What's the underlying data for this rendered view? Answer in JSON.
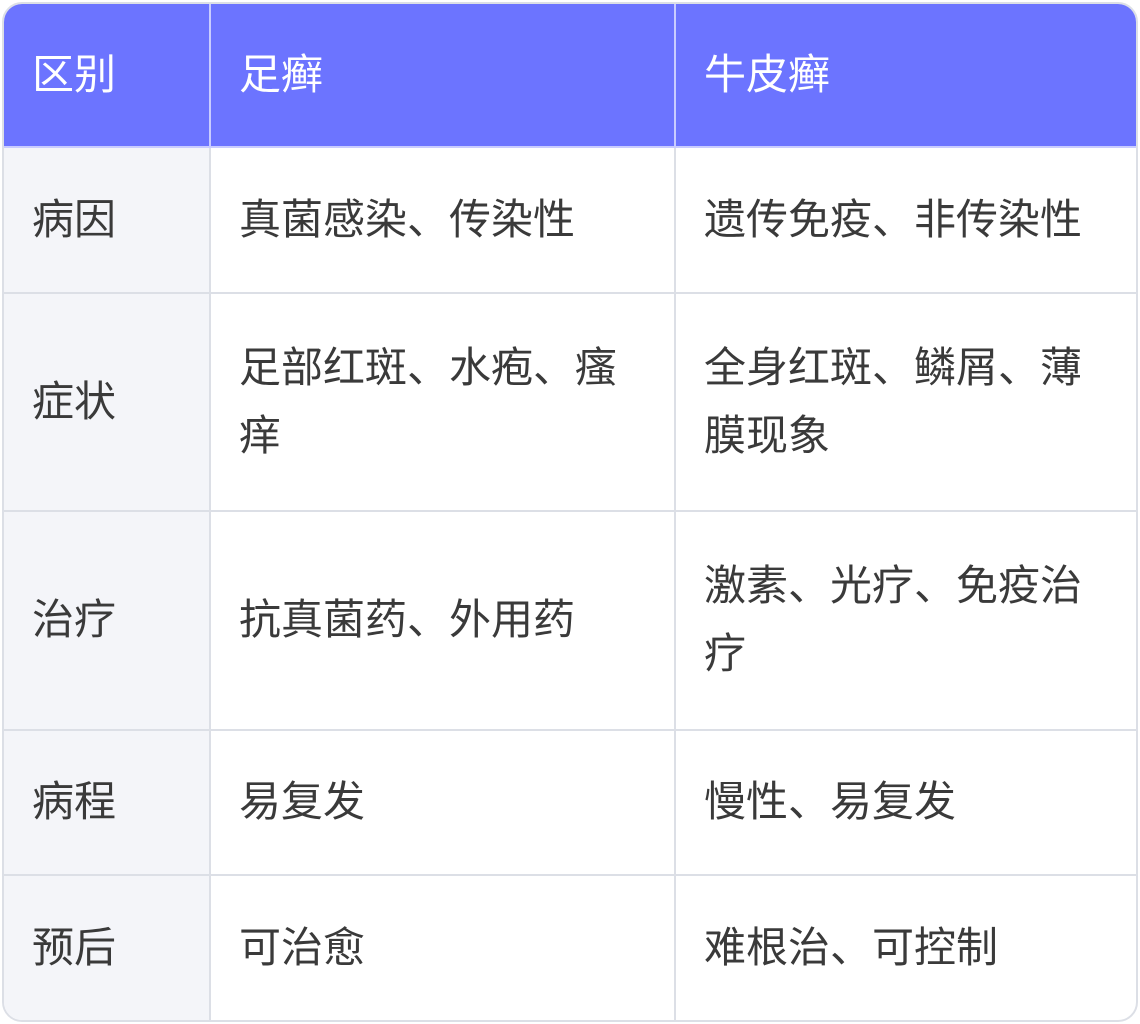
{
  "header": {
    "col_label": "区别",
    "col_a": "足癣",
    "col_b": "牛皮癣"
  },
  "rows": [
    {
      "label": "病因",
      "a": "真菌感染、传染性",
      "b": "遗传免疫、非传染性"
    },
    {
      "label": "症状",
      "a": "足部红斑、水疱、瘙痒",
      "b": "全身红斑、鳞屑、薄膜现象"
    },
    {
      "label": "治疗",
      "a": "抗真菌药、外用药",
      "b": "激素、光疗、免疫治疗"
    },
    {
      "label": "病程",
      "a": "易复发",
      "b": "慢性、易复发"
    },
    {
      "label": "预后",
      "a": "可治愈",
      "b": "难根治、可控制"
    }
  ],
  "colors": {
    "header_bg": "#6c74ff",
    "label_bg": "#f4f5f9",
    "border": "#dcdfe6"
  }
}
